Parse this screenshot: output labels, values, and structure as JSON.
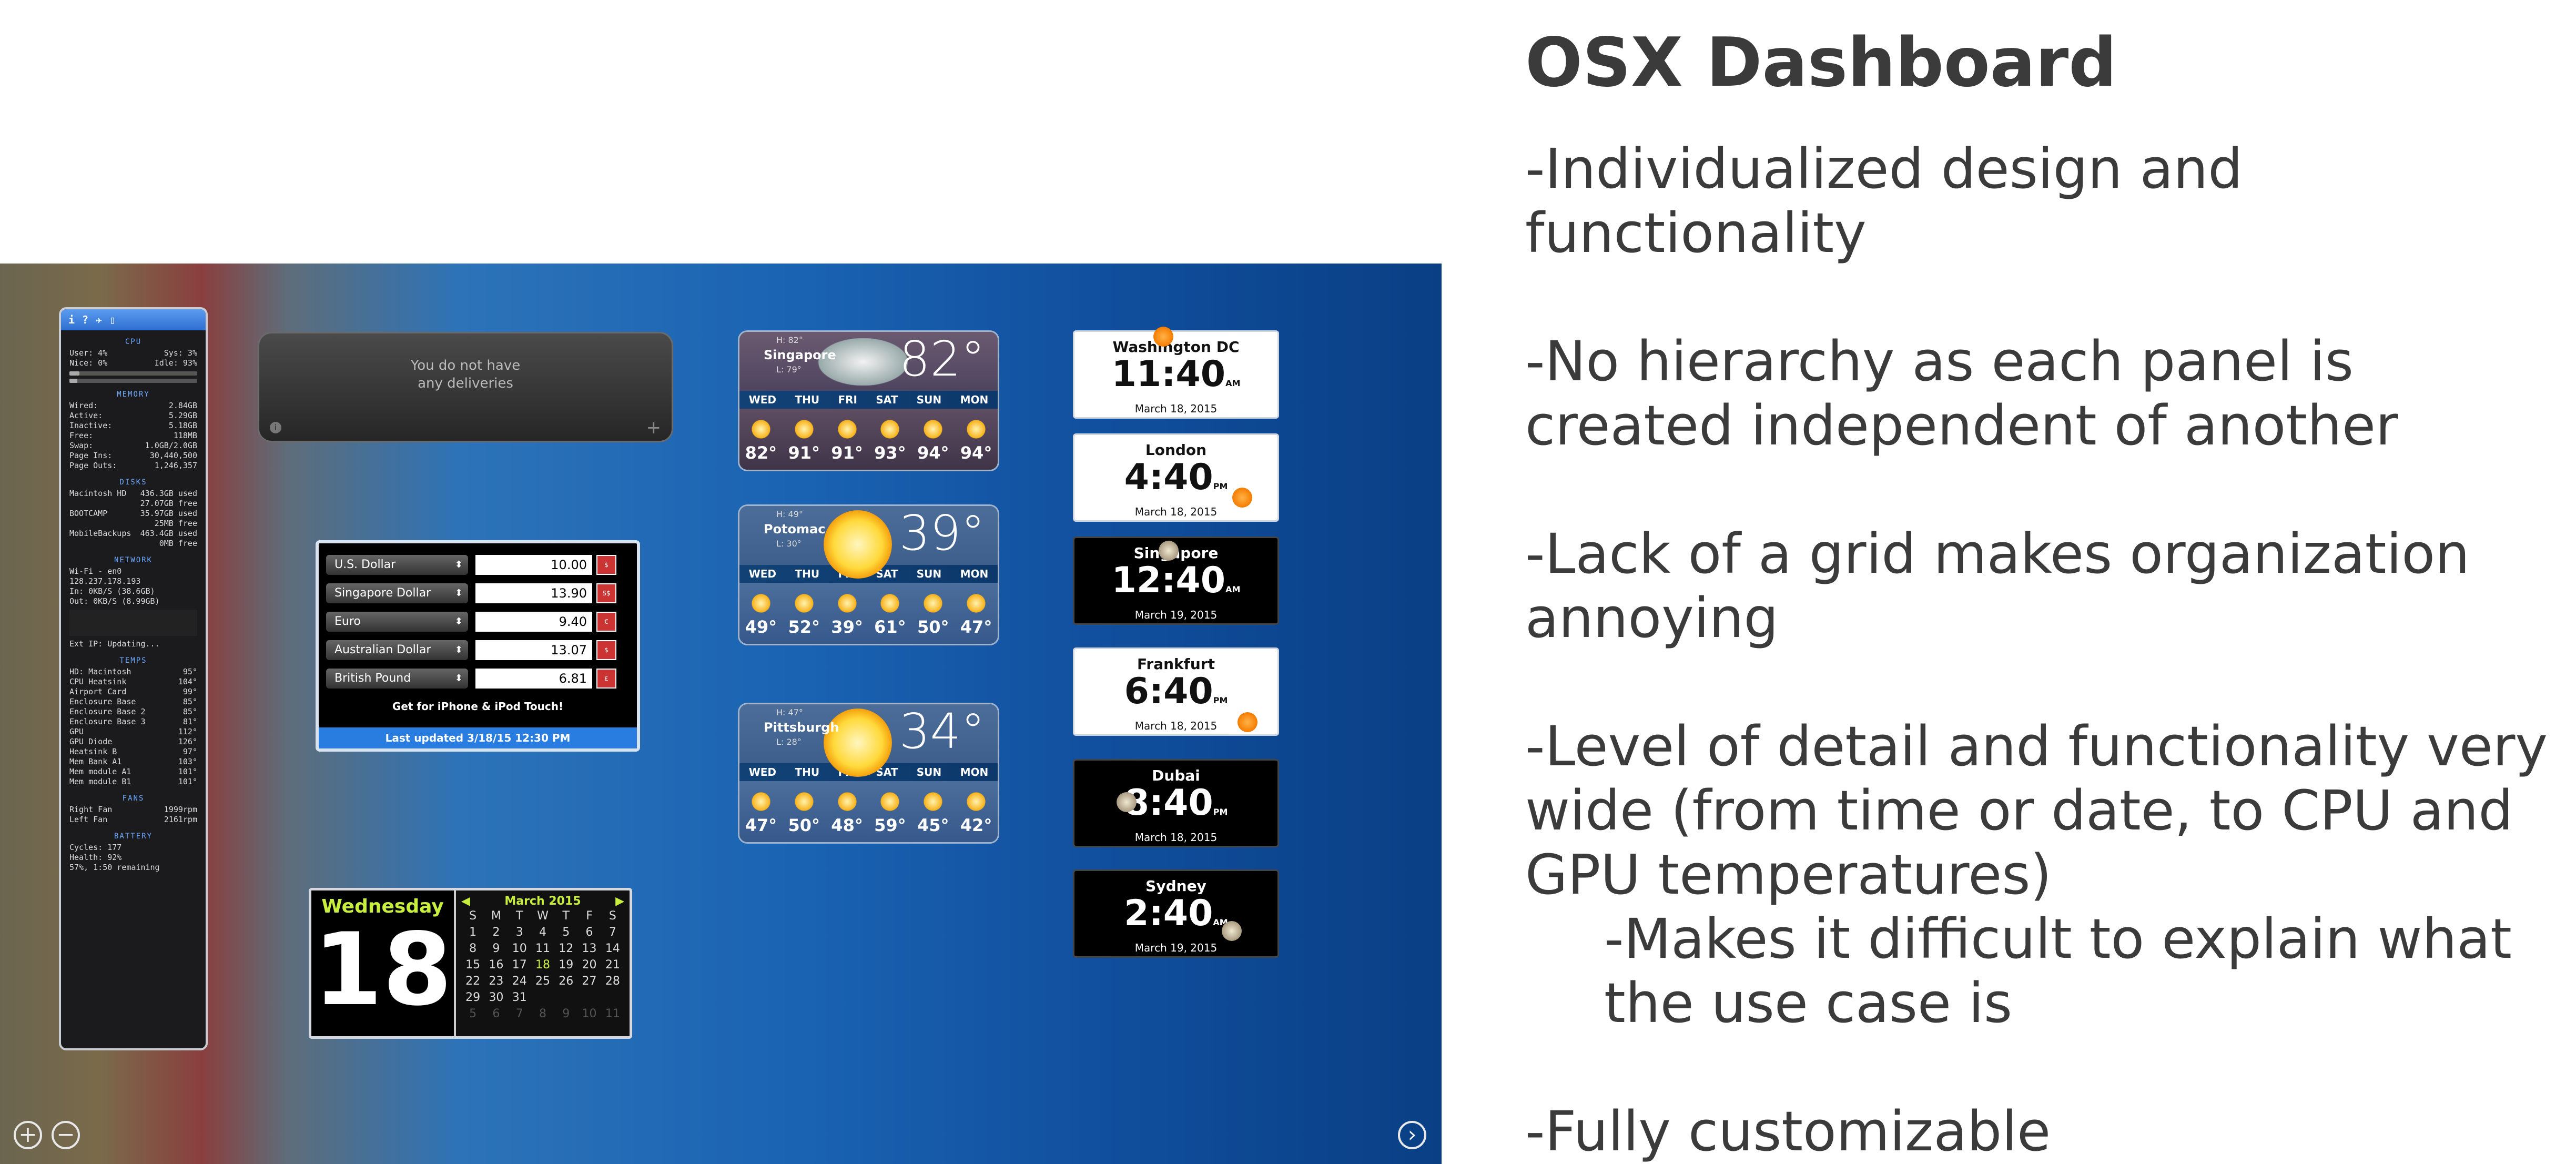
{
  "slide": {
    "title": "OSX Dashboard",
    "bullets": [
      "-Individualized design and functionality",
      "-No hierarchy as each panel is created independent of another",
      "-Lack of a grid makes organization annoying",
      "-Level of detail and functionality very wide (from time or date, to CPU and GPU temperatures)",
      "-Makes it difficult to explain what the use case is",
      "-Fully customizable"
    ]
  },
  "istat": {
    "tabs": [
      "i",
      "?",
      "✈",
      "▯"
    ],
    "cpu": {
      "title": "CPU",
      "user": "User: 4%",
      "sys": "Sys: 3%",
      "nice": "Nice: 0%",
      "idle": "Idle: 93%"
    },
    "memory": {
      "title": "MEMORY",
      "rows": [
        [
          "Wired:",
          "2.84GB"
        ],
        [
          "Active:",
          "5.29GB"
        ],
        [
          "Inactive:",
          "5.18GB"
        ],
        [
          "Free:",
          "118MB"
        ],
        [
          "Swap:",
          "1.0GB/2.0GB"
        ],
        [
          "Page Ins:",
          "30,440,500"
        ],
        [
          "Page Outs:",
          "1,246,357"
        ]
      ]
    },
    "disks": {
      "title": "DISKS",
      "rows": [
        [
          "Macintosh HD",
          "436.3GB used"
        ],
        [
          "",
          "27.07GB free"
        ],
        [
          "BOOTCAMP",
          "35.97GB used"
        ],
        [
          "",
          "25MB free"
        ],
        [
          "MobileBackups",
          "463.4GB used"
        ],
        [
          "",
          "0MB free"
        ]
      ]
    },
    "network": {
      "title": "NETWORK",
      "wifi": "Wi-Fi - en0",
      "ip": "128.237.178.193",
      "in": "In: 0KB/S (38.6GB)",
      "out": "Out: 0KB/S (8.99GB)",
      "ext": "Ext IP: Updating..."
    },
    "temps": {
      "title": "TEMPS",
      "rows": [
        [
          "HD: Macintosh",
          "95°"
        ],
        [
          "CPU Heatsink",
          "104°"
        ],
        [
          "Airport Card",
          "99°"
        ],
        [
          "Enclosure Base",
          "85°"
        ],
        [
          "Enclosure Base 2",
          "85°"
        ],
        [
          "Enclosure Base 3",
          "81°"
        ],
        [
          "GPU",
          "112°"
        ],
        [
          "GPU Diode",
          "126°"
        ],
        [
          "Heatsink B",
          "97°"
        ],
        [
          "Mem Bank A1",
          "103°"
        ],
        [
          "Mem module A1",
          "101°"
        ],
        [
          "Mem module B1",
          "101°"
        ]
      ]
    },
    "fans": {
      "title": "FANS",
      "rows": [
        [
          "Right Fan",
          "1999rpm"
        ],
        [
          "Left Fan",
          "2161rpm"
        ]
      ]
    },
    "battery": {
      "title": "BATTERY",
      "cycles": "Cycles: 177",
      "health": "Health: 92%",
      "remaining": "57%, 1:50 remaining"
    }
  },
  "delivery": {
    "line1": "You do not have",
    "line2": "any deliveries",
    "info": "i",
    "add": "+"
  },
  "currency": {
    "rows": [
      {
        "name": "U.S. Dollar",
        "value": "10.00",
        "sym": "$"
      },
      {
        "name": "Singapore Dollar",
        "value": "13.90",
        "sym": "S$"
      },
      {
        "name": "Euro",
        "value": "9.40",
        "sym": "€"
      },
      {
        "name": "Australian Dollar",
        "value": "13.07",
        "sym": "$"
      },
      {
        "name": "British Pound",
        "value": "6.81",
        "sym": "£"
      }
    ],
    "promo": "Get for iPhone & iPod Touch!",
    "updated": "Last updated 3/18/15 12:30 PM"
  },
  "weather": [
    {
      "city": "Singapore",
      "hi": "H: 82°",
      "lo": "L: 79°",
      "temp": "82°",
      "days": [
        "WED",
        "THU",
        "FRI",
        "SAT",
        "SUN",
        "MON"
      ],
      "temps": [
        "82°",
        "91°",
        "91°",
        "93°",
        "94°",
        "94°"
      ]
    },
    {
      "city": "Potomac",
      "hi": "H: 49°",
      "lo": "L: 30°",
      "temp": "39°",
      "days": [
        "WED",
        "THU",
        "FRI",
        "SAT",
        "SUN",
        "MON"
      ],
      "temps": [
        "49°",
        "52°",
        "39°",
        "61°",
        "50°",
        "47°"
      ]
    },
    {
      "city": "Pittsburgh",
      "hi": "H: 47°",
      "lo": "L: 28°",
      "temp": "34°",
      "days": [
        "WED",
        "THU",
        "FRI",
        "SAT",
        "SUN",
        "MON"
      ],
      "temps": [
        "47°",
        "50°",
        "48°",
        "59°",
        "45°",
        "42°"
      ]
    }
  ],
  "clocks": [
    {
      "city": "Washington DC",
      "time": "11:40",
      "ampm": "AM",
      "date": "March 18, 2015",
      "mode": "day"
    },
    {
      "city": "London",
      "time": "4:40",
      "ampm": "PM",
      "date": "March 18, 2015",
      "mode": "day"
    },
    {
      "city": "Singapore",
      "time": "12:40",
      "ampm": "AM",
      "date": "March 19, 2015",
      "mode": "night"
    },
    {
      "city": "Frankfurt",
      "time": "6:40",
      "ampm": "PM",
      "date": "March 18, 2015",
      "mode": "day"
    },
    {
      "city": "Dubai",
      "time": "8:40",
      "ampm": "PM",
      "date": "March 18, 2015",
      "mode": "night"
    },
    {
      "city": "Sydney",
      "time": "2:40",
      "ampm": "AM",
      "date": "March 19, 2015",
      "mode": "night"
    }
  ],
  "calendar": {
    "weekday": "Wednesday",
    "day": "18",
    "month": "March 2015",
    "headers": [
      "S",
      "M",
      "T",
      "W",
      "T",
      "F",
      "S"
    ],
    "weeks": [
      [
        "1",
        "2",
        "3",
        "4",
        "5",
        "6",
        "7"
      ],
      [
        "8",
        "9",
        "10",
        "11",
        "12",
        "13",
        "14"
      ],
      [
        "15",
        "16",
        "17",
        "18",
        "19",
        "20",
        "21"
      ],
      [
        "22",
        "23",
        "24",
        "25",
        "26",
        "27",
        "28"
      ],
      [
        "29",
        "30",
        "31",
        "",
        "",
        "",
        ""
      ],
      [
        "5",
        "6",
        "7",
        "8",
        "9",
        "10",
        "11"
      ]
    ]
  },
  "controls": {
    "add": "+",
    "remove": "−",
    "next": "›"
  }
}
